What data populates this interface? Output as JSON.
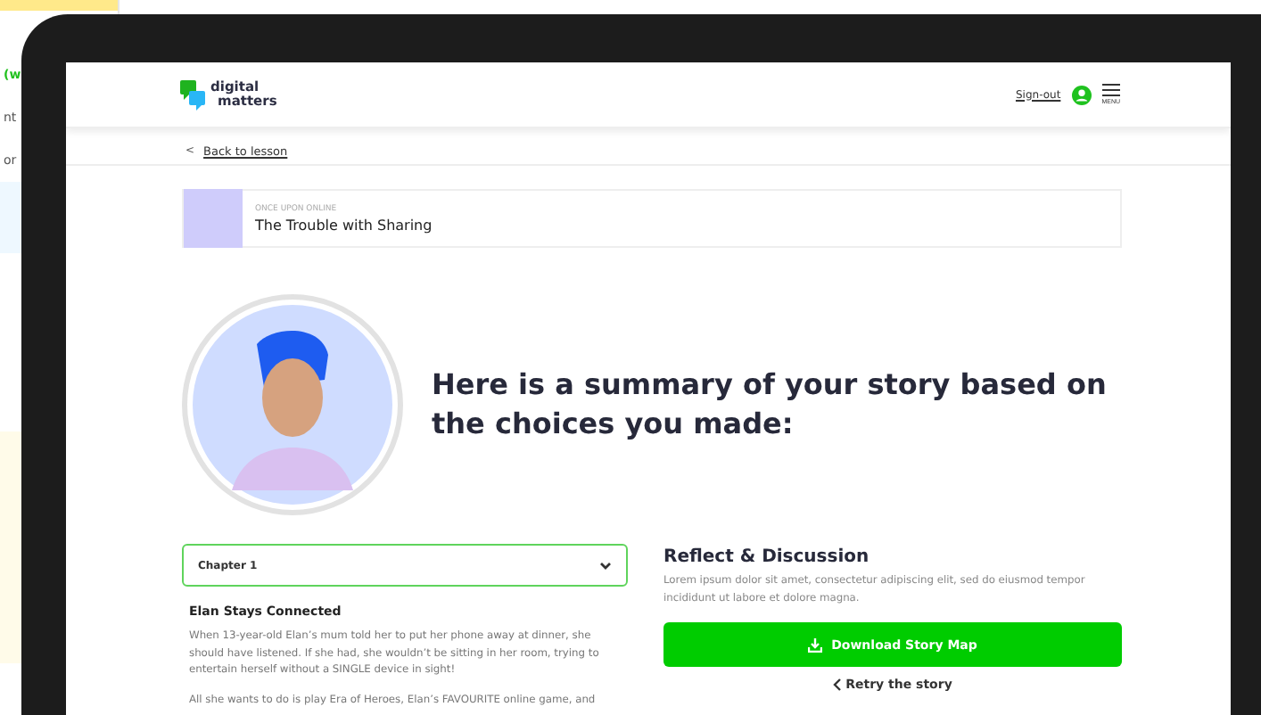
{
  "background_page": {
    "fragments": [
      {
        "text": "(w",
        "kind": "accent"
      },
      {
        "text": "nt",
        "kind": "plain"
      },
      {
        "text": "or",
        "kind": "plain"
      }
    ]
  },
  "header": {
    "logo": {
      "line_1": "digital",
      "line_2": "matters"
    },
    "sign_out": "Sign-out",
    "menu_label": "MENU"
  },
  "back_link": {
    "arrow": "<",
    "label": "Back to lesson"
  },
  "lesson": {
    "series": "ONCE UPON ONLINE",
    "title": "The Trouble with Sharing"
  },
  "summary_heading": "Here is a summary of your story based on the choices you made:",
  "chapter_select": {
    "value": "Chapter 1",
    "expanded": false
  },
  "story": {
    "title": "Elan Stays Connected",
    "paragraphs": [
      "When 13-year-old Elan’s mum told her to put her phone away at dinner, she should have listened. If she had, she wouldn’t be sitting in her room, trying to entertain herself without a SINGLE device in sight!",
      "All she wants to do is play Era of Heroes, Elan’s FAVOURITE online game, and"
    ]
  },
  "reflect": {
    "title": "Reflect & Discussion",
    "text": "Lorem ipsum dolor sit amet, consectetur adipiscing elit, sed do eiusmod tempor incididunt ut labore et dolore magna.",
    "download_button": "Download Story Map",
    "retry_link": "Retry the story"
  }
}
